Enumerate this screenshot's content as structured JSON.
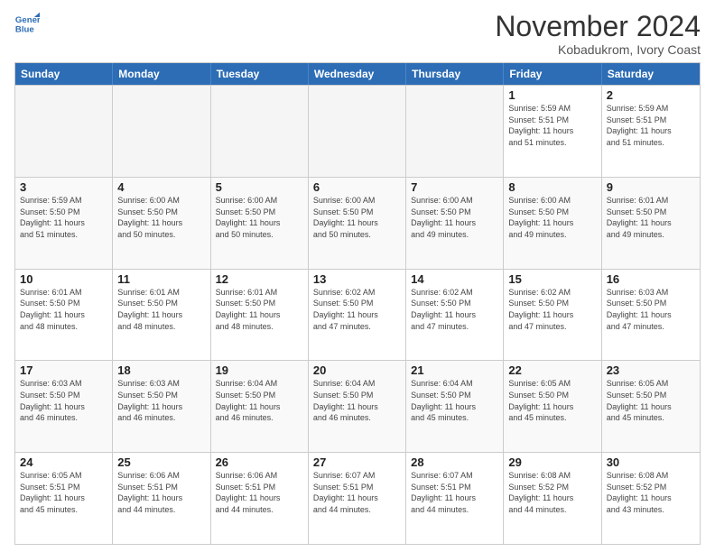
{
  "header": {
    "logo_line1": "General",
    "logo_line2": "Blue",
    "month": "November 2024",
    "location": "Kobadukrom, Ivory Coast"
  },
  "weekdays": [
    "Sunday",
    "Monday",
    "Tuesday",
    "Wednesday",
    "Thursday",
    "Friday",
    "Saturday"
  ],
  "rows": [
    [
      {
        "day": "",
        "info": ""
      },
      {
        "day": "",
        "info": ""
      },
      {
        "day": "",
        "info": ""
      },
      {
        "day": "",
        "info": ""
      },
      {
        "day": "",
        "info": ""
      },
      {
        "day": "1",
        "info": "Sunrise: 5:59 AM\nSunset: 5:51 PM\nDaylight: 11 hours\nand 51 minutes."
      },
      {
        "day": "2",
        "info": "Sunrise: 5:59 AM\nSunset: 5:51 PM\nDaylight: 11 hours\nand 51 minutes."
      }
    ],
    [
      {
        "day": "3",
        "info": "Sunrise: 5:59 AM\nSunset: 5:50 PM\nDaylight: 11 hours\nand 51 minutes."
      },
      {
        "day": "4",
        "info": "Sunrise: 6:00 AM\nSunset: 5:50 PM\nDaylight: 11 hours\nand 50 minutes."
      },
      {
        "day": "5",
        "info": "Sunrise: 6:00 AM\nSunset: 5:50 PM\nDaylight: 11 hours\nand 50 minutes."
      },
      {
        "day": "6",
        "info": "Sunrise: 6:00 AM\nSunset: 5:50 PM\nDaylight: 11 hours\nand 50 minutes."
      },
      {
        "day": "7",
        "info": "Sunrise: 6:00 AM\nSunset: 5:50 PM\nDaylight: 11 hours\nand 49 minutes."
      },
      {
        "day": "8",
        "info": "Sunrise: 6:00 AM\nSunset: 5:50 PM\nDaylight: 11 hours\nand 49 minutes."
      },
      {
        "day": "9",
        "info": "Sunrise: 6:01 AM\nSunset: 5:50 PM\nDaylight: 11 hours\nand 49 minutes."
      }
    ],
    [
      {
        "day": "10",
        "info": "Sunrise: 6:01 AM\nSunset: 5:50 PM\nDaylight: 11 hours\nand 48 minutes."
      },
      {
        "day": "11",
        "info": "Sunrise: 6:01 AM\nSunset: 5:50 PM\nDaylight: 11 hours\nand 48 minutes."
      },
      {
        "day": "12",
        "info": "Sunrise: 6:01 AM\nSunset: 5:50 PM\nDaylight: 11 hours\nand 48 minutes."
      },
      {
        "day": "13",
        "info": "Sunrise: 6:02 AM\nSunset: 5:50 PM\nDaylight: 11 hours\nand 47 minutes."
      },
      {
        "day": "14",
        "info": "Sunrise: 6:02 AM\nSunset: 5:50 PM\nDaylight: 11 hours\nand 47 minutes."
      },
      {
        "day": "15",
        "info": "Sunrise: 6:02 AM\nSunset: 5:50 PM\nDaylight: 11 hours\nand 47 minutes."
      },
      {
        "day": "16",
        "info": "Sunrise: 6:03 AM\nSunset: 5:50 PM\nDaylight: 11 hours\nand 47 minutes."
      }
    ],
    [
      {
        "day": "17",
        "info": "Sunrise: 6:03 AM\nSunset: 5:50 PM\nDaylight: 11 hours\nand 46 minutes."
      },
      {
        "day": "18",
        "info": "Sunrise: 6:03 AM\nSunset: 5:50 PM\nDaylight: 11 hours\nand 46 minutes."
      },
      {
        "day": "19",
        "info": "Sunrise: 6:04 AM\nSunset: 5:50 PM\nDaylight: 11 hours\nand 46 minutes."
      },
      {
        "day": "20",
        "info": "Sunrise: 6:04 AM\nSunset: 5:50 PM\nDaylight: 11 hours\nand 46 minutes."
      },
      {
        "day": "21",
        "info": "Sunrise: 6:04 AM\nSunset: 5:50 PM\nDaylight: 11 hours\nand 45 minutes."
      },
      {
        "day": "22",
        "info": "Sunrise: 6:05 AM\nSunset: 5:50 PM\nDaylight: 11 hours\nand 45 minutes."
      },
      {
        "day": "23",
        "info": "Sunrise: 6:05 AM\nSunset: 5:50 PM\nDaylight: 11 hours\nand 45 minutes."
      }
    ],
    [
      {
        "day": "24",
        "info": "Sunrise: 6:05 AM\nSunset: 5:51 PM\nDaylight: 11 hours\nand 45 minutes."
      },
      {
        "day": "25",
        "info": "Sunrise: 6:06 AM\nSunset: 5:51 PM\nDaylight: 11 hours\nand 44 minutes."
      },
      {
        "day": "26",
        "info": "Sunrise: 6:06 AM\nSunset: 5:51 PM\nDaylight: 11 hours\nand 44 minutes."
      },
      {
        "day": "27",
        "info": "Sunrise: 6:07 AM\nSunset: 5:51 PM\nDaylight: 11 hours\nand 44 minutes."
      },
      {
        "day": "28",
        "info": "Sunrise: 6:07 AM\nSunset: 5:51 PM\nDaylight: 11 hours\nand 44 minutes."
      },
      {
        "day": "29",
        "info": "Sunrise: 6:08 AM\nSunset: 5:52 PM\nDaylight: 11 hours\nand 44 minutes."
      },
      {
        "day": "30",
        "info": "Sunrise: 6:08 AM\nSunset: 5:52 PM\nDaylight: 11 hours\nand 43 minutes."
      }
    ]
  ]
}
